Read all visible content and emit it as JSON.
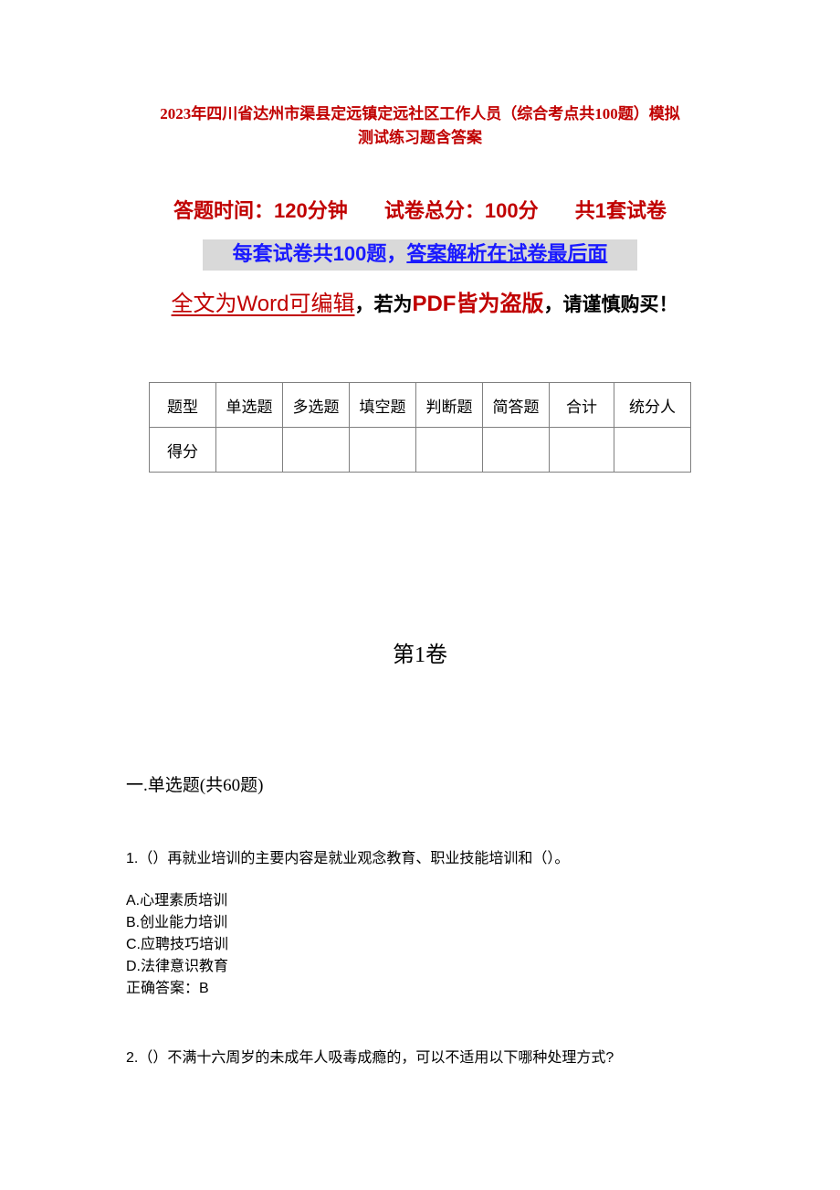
{
  "document": {
    "title_line1": "2023年四川省达州市渠县定远镇定远社区工作人员（综合考点共100题）模拟",
    "title_line2": "测试练习题含答案",
    "meta": {
      "time": "答题时间：120分钟",
      "total": "试卷总分：100分",
      "sets": "共1套试卷"
    },
    "banner": {
      "part1": "每套试卷共100题，",
      "part2": "答案解析在试卷最后面"
    },
    "notice": {
      "part1": "全文为Word可编辑",
      "sep1": "，若为",
      "part2": "PDF皆为盗版",
      "part3": "，请谨慎购买！"
    },
    "score_table": {
      "headers": [
        "题型",
        "单选题",
        "多选题",
        "填空题",
        "判断题",
        "简答题",
        "合计",
        "统分人"
      ],
      "row_label": "得分",
      "values": [
        "",
        "",
        "",
        "",
        "",
        "",
        ""
      ]
    },
    "volume_title": "第1卷",
    "section_title": "一.单选题(共60题)",
    "questions": [
      {
        "stem": "1.（）再就业培训的主要内容是就业观念教育、职业技能培训和（）。",
        "options": [
          "A.心理素质培训",
          "B.创业能力培训",
          "C.应聘技巧培训",
          "D.法律意识教育"
        ],
        "answer": "正确答案：B"
      },
      {
        "stem": "2.（）不满十六周岁的未成年人吸毒成瘾的，可以不适用以下哪种处理方式?"
      }
    ]
  }
}
